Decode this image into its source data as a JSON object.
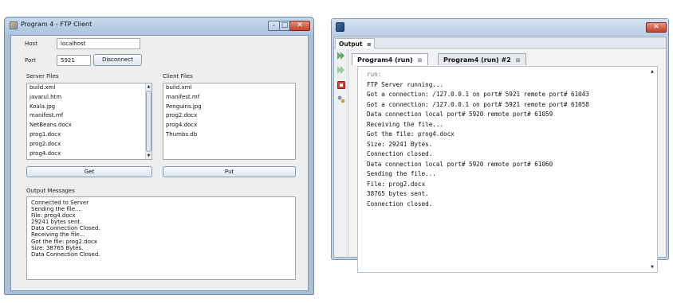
{
  "ftp_client": {
    "title": "Program 4 - FTP Client",
    "host_label": "Host",
    "host_value": "localhost",
    "port_label": "Port",
    "port_value": "5921",
    "disconnect_label": "Disconnect",
    "server_files_label": "Server Files",
    "server_files": [
      "build.xml",
      "javarul.htm",
      "Koala.jpg",
      "manifest.mf",
      "NetBeans.docx",
      "prog1.docx",
      "prog2.docx",
      "prog4.docx"
    ],
    "client_files_label": "Client Files",
    "client_files": [
      "build.xml",
      "manifest.mf",
      "Penguins.jpg",
      "prog2.docx",
      "prog4.docx",
      "Thumbs.db"
    ],
    "get_label": "Get",
    "put_label": "Put",
    "output_messages_label": "Output Messages",
    "output_messages": [
      "Connected to Server",
      "Sending the file....",
      "File: prog4.docx",
      "29241 bytes sent.",
      "Data Connection Closed.",
      "Receiving the file...",
      "Got the file: prog2.docx",
      "Size: 38765 Bytes.",
      "Data Connection Closed."
    ]
  },
  "output_window": {
    "panel_title": "Output",
    "tabs": [
      {
        "label": "Program4 (run)",
        "close": "⊠"
      },
      {
        "label": "Program4 (run) #2",
        "close": "⊠"
      }
    ],
    "console_lines": [
      "run:",
      "FTP Server running...",
      "Got a connection: /127.0.0.1 on port# 5921 remote port# 61043",
      "Got a connection: /127.0.0.1 on port# 5921 remote port# 61058",
      "Data connection local port# 5920 remote port# 61059",
      "Receiving the file...",
      "Got the file: prog4.docx",
      "Size: 29241 Bytes.",
      "Connection closed.",
      "Data connection local port# 5920 remote port# 61060",
      "Sending the file...",
      "File: prog2.docx",
      "38765 bytes sent.",
      "Connection closed."
    ]
  },
  "colors": {
    "window_frame": "#a9c0da",
    "close_button": "#c2402b",
    "run_arrow": "#5bb05b",
    "stop_button": "#d9412e"
  }
}
